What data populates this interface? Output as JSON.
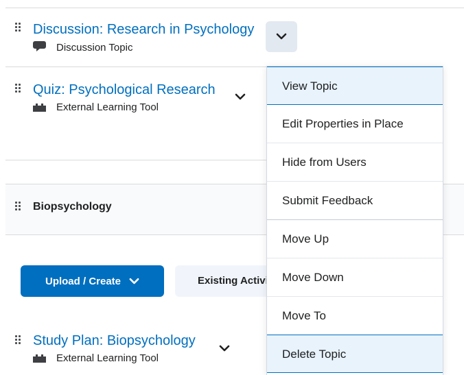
{
  "items": [
    {
      "title": "Discussion: Research in Psychology",
      "subtitle": "Discussion Topic",
      "icon": "discussion-icon"
    },
    {
      "title": "Quiz: Psychological Research",
      "subtitle": "External Learning Tool",
      "icon": "puzzle-icon"
    },
    {
      "title": "Study Plan: Biopsychology",
      "subtitle": "External Learning Tool",
      "icon": "puzzle-icon"
    }
  ],
  "section": {
    "title": "Biopsychology"
  },
  "buttons": {
    "upload_create": "Upload / Create",
    "existing_activities": "Existing Activities"
  },
  "menu": {
    "items": [
      {
        "label": "View Topic",
        "highlighted": true
      },
      {
        "label": "Edit Properties in Place"
      },
      {
        "label": "Hide from Users"
      },
      {
        "label": "Submit Feedback"
      },
      {
        "label": "Move Up"
      },
      {
        "label": "Move Down"
      },
      {
        "label": "Move To"
      },
      {
        "label": "Delete Topic",
        "highlighted": true
      }
    ]
  },
  "colors": {
    "link": "#006fbf",
    "primary": "#006fbf",
    "highlight": "#e8f3fc"
  }
}
